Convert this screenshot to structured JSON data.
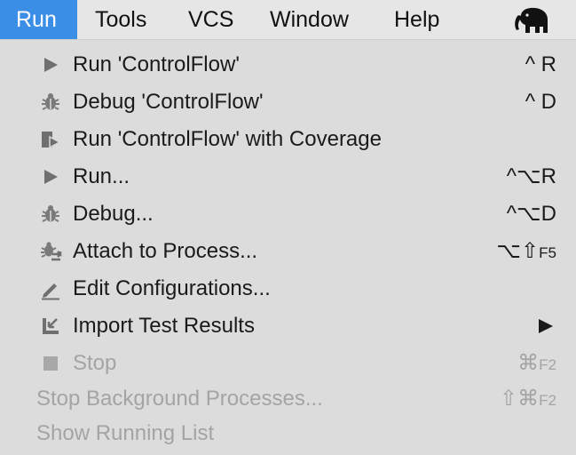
{
  "menubar": {
    "items": [
      {
        "label": "Run",
        "active": true
      },
      {
        "label": "Tools"
      },
      {
        "label": "VCS"
      },
      {
        "label": "Window"
      },
      {
        "label": "Help"
      }
    ],
    "app_icon": "elephant-icon"
  },
  "menu": {
    "items": [
      {
        "label": "Run 'ControlFlow'",
        "shortcut_main": "^ R",
        "icon": "run-icon"
      },
      {
        "label": "Debug 'ControlFlow'",
        "shortcut_main": "^ D",
        "icon": "debug-icon"
      },
      {
        "label": "Run 'ControlFlow' with Coverage",
        "icon": "coverage-icon"
      },
      {
        "label": "Run...",
        "shortcut_main": "^⌥R",
        "icon": "run-icon"
      },
      {
        "label": "Debug...",
        "shortcut_main": "^⌥D",
        "icon": "debug-icon"
      },
      {
        "label": "Attach to Process...",
        "shortcut_main": "⌥⇧",
        "shortcut_small": "F5",
        "icon": "attach-icon"
      },
      {
        "label": "Edit Configurations...",
        "icon": "edit-icon"
      },
      {
        "label": "Import Test Results",
        "icon": "import-icon",
        "submenu": true
      },
      {
        "label": "Stop",
        "shortcut_main": "⌘",
        "shortcut_small": "F2",
        "icon": "stop-icon",
        "disabled": true
      },
      {
        "label": "Stop Background Processes...",
        "shortcut_main": "⇧⌘",
        "shortcut_small": "F2",
        "disabled": true
      },
      {
        "label": "Show Running List",
        "disabled": true
      }
    ]
  },
  "colors": {
    "menubar_bg": "#e6e6e6",
    "active_bg": "#3a8ee6",
    "menu_bg": "#dcdcdc",
    "text": "#1a1a1a",
    "disabled_text": "#a4a4a4",
    "icon_gray": "#6f6f6f"
  }
}
